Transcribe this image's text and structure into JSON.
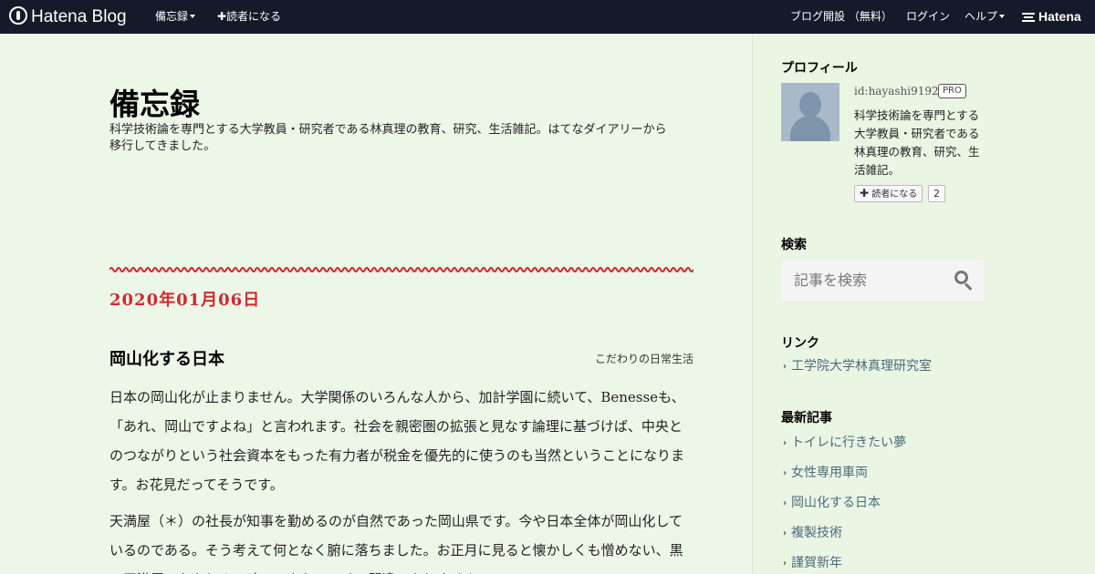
{
  "nav": {
    "logo_text": "Hatena Blog",
    "blog_menu": "備忘録",
    "subscribe": "✚読者になる",
    "signup": "ブログ開設 （無料）",
    "login": "ログイン",
    "help": "ヘルプ",
    "hatena_logo": "Hatena"
  },
  "blog": {
    "title": "備忘録",
    "description": "科学技術論を専門とする大学教員・研究者である林真理の教育、研究、生活雑記。はてなダイアリーから移行してきました。"
  },
  "entry": {
    "date": "2020年01月06日",
    "title": "岡山化する日本",
    "category": "こだわりの日常生活",
    "paragraphs": [
      "日本の岡山化が止まりません。大学関係のいろんな人から、加計学園に続いて、Benesseも、「あれ、岡山ですよね」と言われます。社会を親密圏の拡張と見なす論理に基づけば、中央とのつながりという社会資本をもった有力者が税金を優先的に使うのも当然ということになります。お花見だってそうです。",
      "天満屋（＊）の社長が知事を勤めるのが自然であった岡山県です。今や日本全体が岡山化しているのである。そう考えて何となく腑に落ちました。お正月に見ると懐かしくも憎めない、黒い天満屋でおなじみの味の、あれ、です。間違いありません。"
    ]
  },
  "sidebar": {
    "profile": {
      "title": "プロフィール",
      "id": "id:hayashi9192",
      "badge": "PRO",
      "description": "科学技術論を専門とする大学教員・研究者である林真理の教育、研究、生活雑記。",
      "reader_button": "読者になる",
      "reader_count": "2"
    },
    "search": {
      "title": "検索",
      "placeholder": "記事を検索"
    },
    "links": {
      "title": "リンク",
      "items": [
        "工学院大学林真理研究室"
      ]
    },
    "recent": {
      "title": "最新記事",
      "items": [
        "トイレに行きたい夢",
        "女性専用車両",
        "岡山化する日本",
        "複製技術",
        "謹賀新年"
      ]
    }
  }
}
